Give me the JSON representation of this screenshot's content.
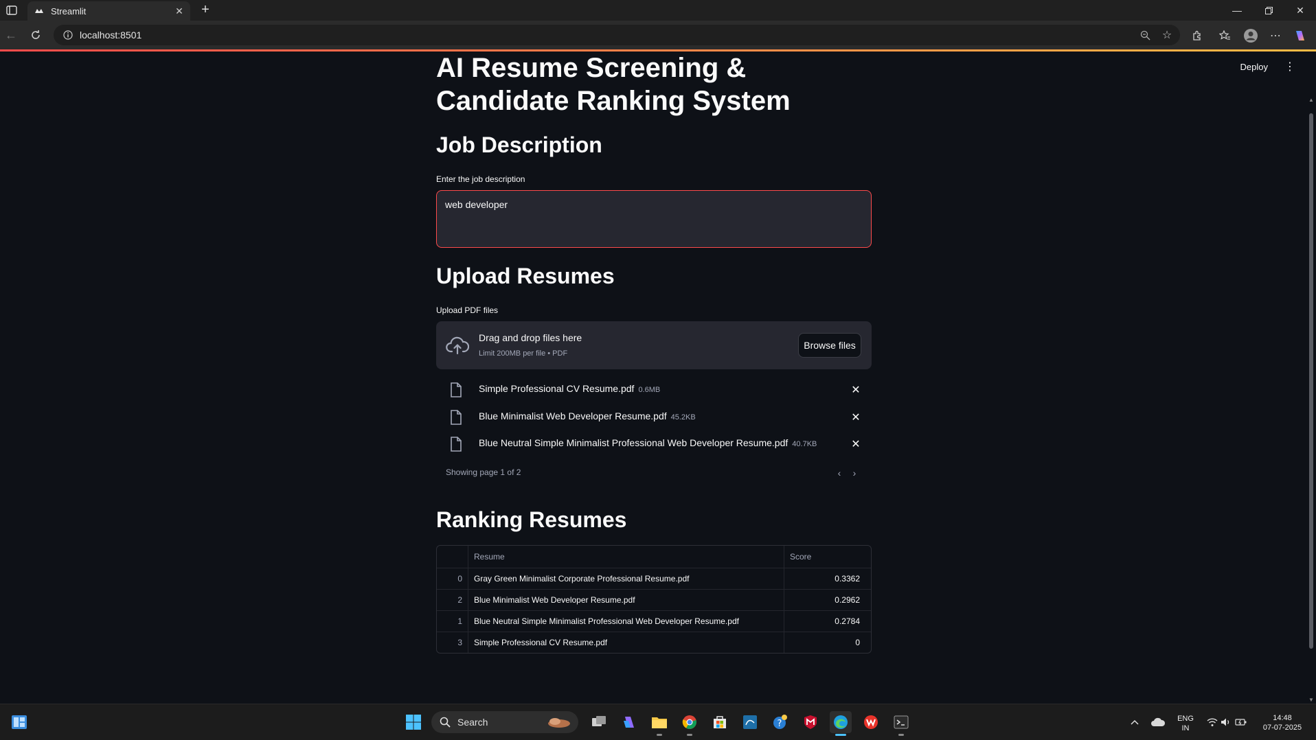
{
  "browser": {
    "tab_title": "Streamlit",
    "url": "localhost:8501"
  },
  "header": {
    "deploy_label": "Deploy"
  },
  "app": {
    "title": "AI Resume Screening & Candidate Ranking System"
  },
  "job_description": {
    "heading": "Job Description",
    "label": "Enter the job description",
    "value": "web developer"
  },
  "upload": {
    "heading": "Upload Resumes",
    "label": "Upload PDF files",
    "drop_title": "Drag and drop files here",
    "drop_limit": "Limit 200MB per file • PDF",
    "browse_label": "Browse files",
    "files": [
      {
        "name": "Simple Professional CV Resume.pdf",
        "size": "0.6MB"
      },
      {
        "name": "Blue Minimalist Web Developer Resume.pdf",
        "size": "45.2KB"
      },
      {
        "name": "Blue Neutral Simple Minimalist Professional Web Developer Resume.pdf",
        "size": "40.7KB"
      }
    ],
    "pager_text": "Showing page 1 of 2"
  },
  "ranking": {
    "heading": "Ranking Resumes",
    "columns": [
      "",
      "Resume",
      "Score"
    ],
    "rows": [
      {
        "index": "0",
        "resume": "Gray Green Minimalist Corporate Professional Resume.pdf",
        "score": "0.3362"
      },
      {
        "index": "2",
        "resume": "Blue Minimalist Web Developer Resume.pdf",
        "score": "0.2962"
      },
      {
        "index": "1",
        "resume": "Blue Neutral Simple Minimalist Professional Web Developer Resume.pdf",
        "score": "0.2784"
      },
      {
        "index": "3",
        "resume": "Simple Professional CV Resume.pdf",
        "score": "0"
      }
    ]
  },
  "taskbar": {
    "search_label": "Search",
    "lang_primary": "ENG",
    "lang_secondary": "IN",
    "time": "14:48",
    "date": "07-07-2025"
  },
  "colors": {
    "accent": "#ff4b4b",
    "background": "#0e1117",
    "widget_bg": "#262730"
  }
}
